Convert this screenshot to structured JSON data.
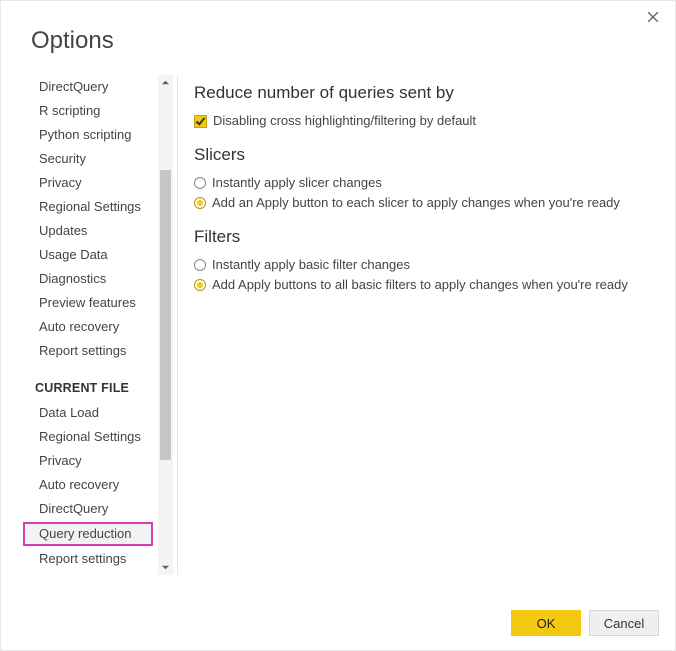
{
  "title": "Options",
  "sidebar": {
    "global_items": [
      "DirectQuery",
      "R scripting",
      "Python scripting",
      "Security",
      "Privacy",
      "Regional Settings",
      "Updates",
      "Usage Data",
      "Diagnostics",
      "Preview features",
      "Auto recovery",
      "Report settings"
    ],
    "current_file_header": "CURRENT FILE",
    "current_file_items": [
      "Data Load",
      "Regional Settings",
      "Privacy",
      "Auto recovery",
      "DirectQuery",
      "Query reduction",
      "Report settings"
    ],
    "selected": "Query reduction"
  },
  "main": {
    "section1": {
      "heading": "Reduce number of queries sent by",
      "checkbox_label": "Disabling cross highlighting/filtering by default"
    },
    "section2": {
      "heading": "Slicers",
      "opt1": "Instantly apply slicer changes",
      "opt2": "Add an Apply button to each slicer to apply changes when you're ready"
    },
    "section3": {
      "heading": "Filters",
      "opt1": "Instantly apply basic filter changes",
      "opt2": "Add Apply buttons to all basic filters to apply changes when you're ready"
    }
  },
  "footer": {
    "ok": "OK",
    "cancel": "Cancel"
  }
}
